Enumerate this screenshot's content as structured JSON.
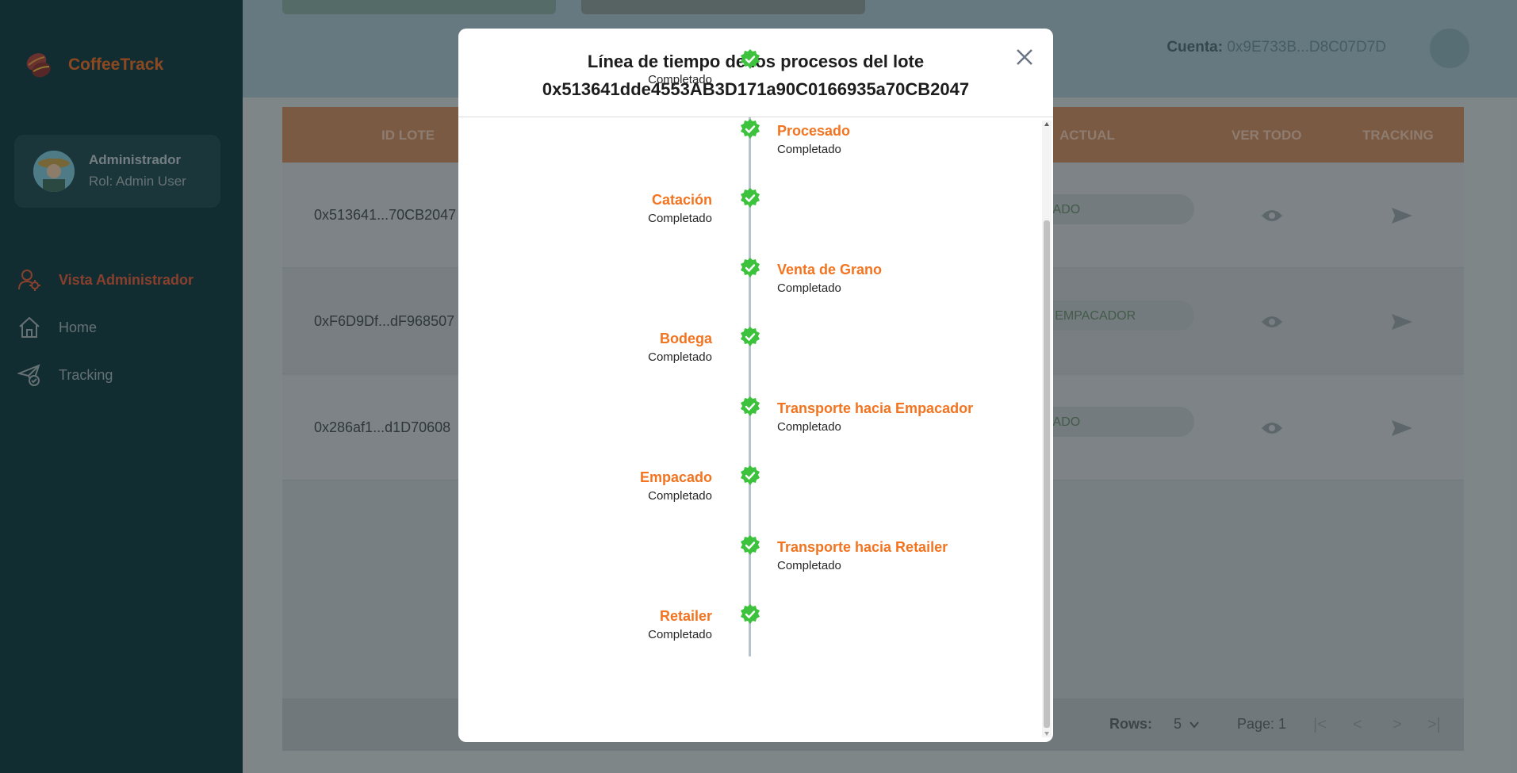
{
  "sidebar": {
    "brand": "CoffeeTrack",
    "user_name": "Administrador",
    "user_role": "Rol: Admin User",
    "nav": [
      {
        "label": "Vista Administrador",
        "icon": "user-gear-icon",
        "active": true
      },
      {
        "label": "Home",
        "icon": "home-icon",
        "active": false
      },
      {
        "label": "Tracking",
        "icon": "send-check-icon",
        "active": false
      }
    ]
  },
  "header": {
    "account_label": "Cuenta:",
    "account_value": "0x9E733B...D8C07D7D"
  },
  "table": {
    "columns": [
      "ID LOTE",
      "ACTUAL",
      "VER TODO",
      "TRACKING"
    ],
    "rows": [
      {
        "id": "0x513641...70CB2047",
        "status": "NADO"
      },
      {
        "id": "0xF6D9Df...dF968507",
        "status": "A EMPACADOR"
      },
      {
        "id": "0x286af1...d1D70608",
        "status": "NADO"
      }
    ],
    "footer": {
      "rows_label": "Rows:",
      "rows_value": "5",
      "page_label": "Page: 1"
    }
  },
  "modal": {
    "title_line1": "Línea de tiempo de los procesos del lote",
    "title_line2": "0x513641dde4553AB3D171a90C0166935a70CB2047",
    "events": [
      {
        "name": "",
        "status": "Completado",
        "side": "left"
      },
      {
        "name": "Procesado",
        "status": "Completado",
        "side": "right"
      },
      {
        "name": "Catación",
        "status": "Completado",
        "side": "left"
      },
      {
        "name": "Venta de Grano",
        "status": "Completado",
        "side": "right"
      },
      {
        "name": "Bodega",
        "status": "Completado",
        "side": "left"
      },
      {
        "name": "Transporte hacia Empacador",
        "status": "Completado",
        "side": "right"
      },
      {
        "name": "Empacado",
        "status": "Completado",
        "side": "left"
      },
      {
        "name": "Transporte hacia Retailer",
        "status": "Completado",
        "side": "right"
      },
      {
        "name": "Retailer",
        "status": "Completado",
        "side": "left"
      }
    ]
  },
  "colors": {
    "accent": "#f27420",
    "sidebar_bg": "#0f3a3e",
    "check_green": "#3cc23c"
  }
}
